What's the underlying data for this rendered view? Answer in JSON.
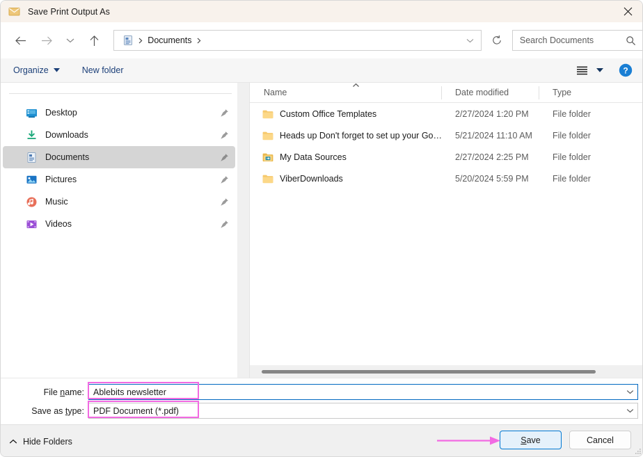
{
  "window": {
    "title": "Save Print Output As",
    "title_icon": "envelope-icon",
    "close_icon": "close-icon"
  },
  "nav": {
    "back_icon": "arrow-left-icon",
    "forward_icon": "arrow-right-icon",
    "recent_icon": "chevron-down-icon",
    "up_icon": "arrow-up-icon",
    "refresh_icon": "refresh-icon",
    "address": {
      "icon": "documents-folder-icon",
      "crumb": "Documents",
      "separator": "›",
      "history_icon": "chevron-down-icon"
    },
    "search": {
      "placeholder": "Search Documents",
      "value": "",
      "icon": "search-icon"
    }
  },
  "toolbar": {
    "organize_label": "Organize",
    "organize_caret_icon": "caret-down-icon",
    "new_folder_label": "New folder",
    "view_icon": "list-view-icon",
    "view_caret_icon": "caret-down-icon",
    "help_icon": "help-icon"
  },
  "sidebar": {
    "items": [
      {
        "label": "Desktop",
        "icon": "desktop-icon",
        "pin": "pin-icon",
        "selected": false
      },
      {
        "label": "Downloads",
        "icon": "downloads-icon",
        "pin": "pin-icon",
        "selected": false
      },
      {
        "label": "Documents",
        "icon": "documents-icon",
        "pin": "pin-icon",
        "selected": true
      },
      {
        "label": "Pictures",
        "icon": "pictures-icon",
        "pin": "pin-icon",
        "selected": false
      },
      {
        "label": "Music",
        "icon": "music-icon",
        "pin": "pin-icon",
        "selected": false
      },
      {
        "label": "Videos",
        "icon": "videos-icon",
        "pin": "pin-icon",
        "selected": false
      }
    ]
  },
  "filelist": {
    "columns": [
      "Name",
      "Date modified",
      "Type"
    ],
    "sort_column": "Name",
    "sort_direction": "ascending",
    "rows": [
      {
        "name": "Custom Office Templates",
        "date": "2/27/2024 1:20 PM",
        "type": "File folder",
        "icon": "folder-icon"
      },
      {
        "name": "Heads up Don't forget to set up your Go…",
        "date": "5/21/2024 11:10 AM",
        "type": "File folder",
        "icon": "folder-icon"
      },
      {
        "name": "My Data Sources",
        "date": "2/27/2024 2:25 PM",
        "type": "File folder",
        "icon": "folder-special-icon"
      },
      {
        "name": "ViberDownloads",
        "date": "5/20/2024 5:59 PM",
        "type": "File folder",
        "icon": "folder-icon"
      }
    ]
  },
  "form": {
    "filename_label_a": "File ",
    "filename_label_accel": "n",
    "filename_label_b": "ame:",
    "filename_value": "Ablebits newsletter",
    "filetype_label_a": "Save as ",
    "filetype_label_accel": "t",
    "filetype_label_b": "ype:",
    "filetype_value": "PDF Document (*.pdf)",
    "dropdown_icon": "chevron-down-icon"
  },
  "footer": {
    "hide_folders_label": "Hide Folders",
    "hide_folders_icon": "chevron-up-icon",
    "save_label_a": "S",
    "save_label_b": "ave",
    "cancel_label": "Cancel",
    "resize_grip_icon": "resize-grip-icon"
  },
  "annotations": {
    "highlight_color": "#f26ae2",
    "arrow_icon": "arrow-right-annotation"
  },
  "colors": {
    "titlebar_bg": "#f8f2ec",
    "accent_blue": "#0078d4",
    "link_blue": "#1b3f78",
    "selected_gray": "#d5d5d5",
    "annotation_pink": "#f26ae2"
  }
}
